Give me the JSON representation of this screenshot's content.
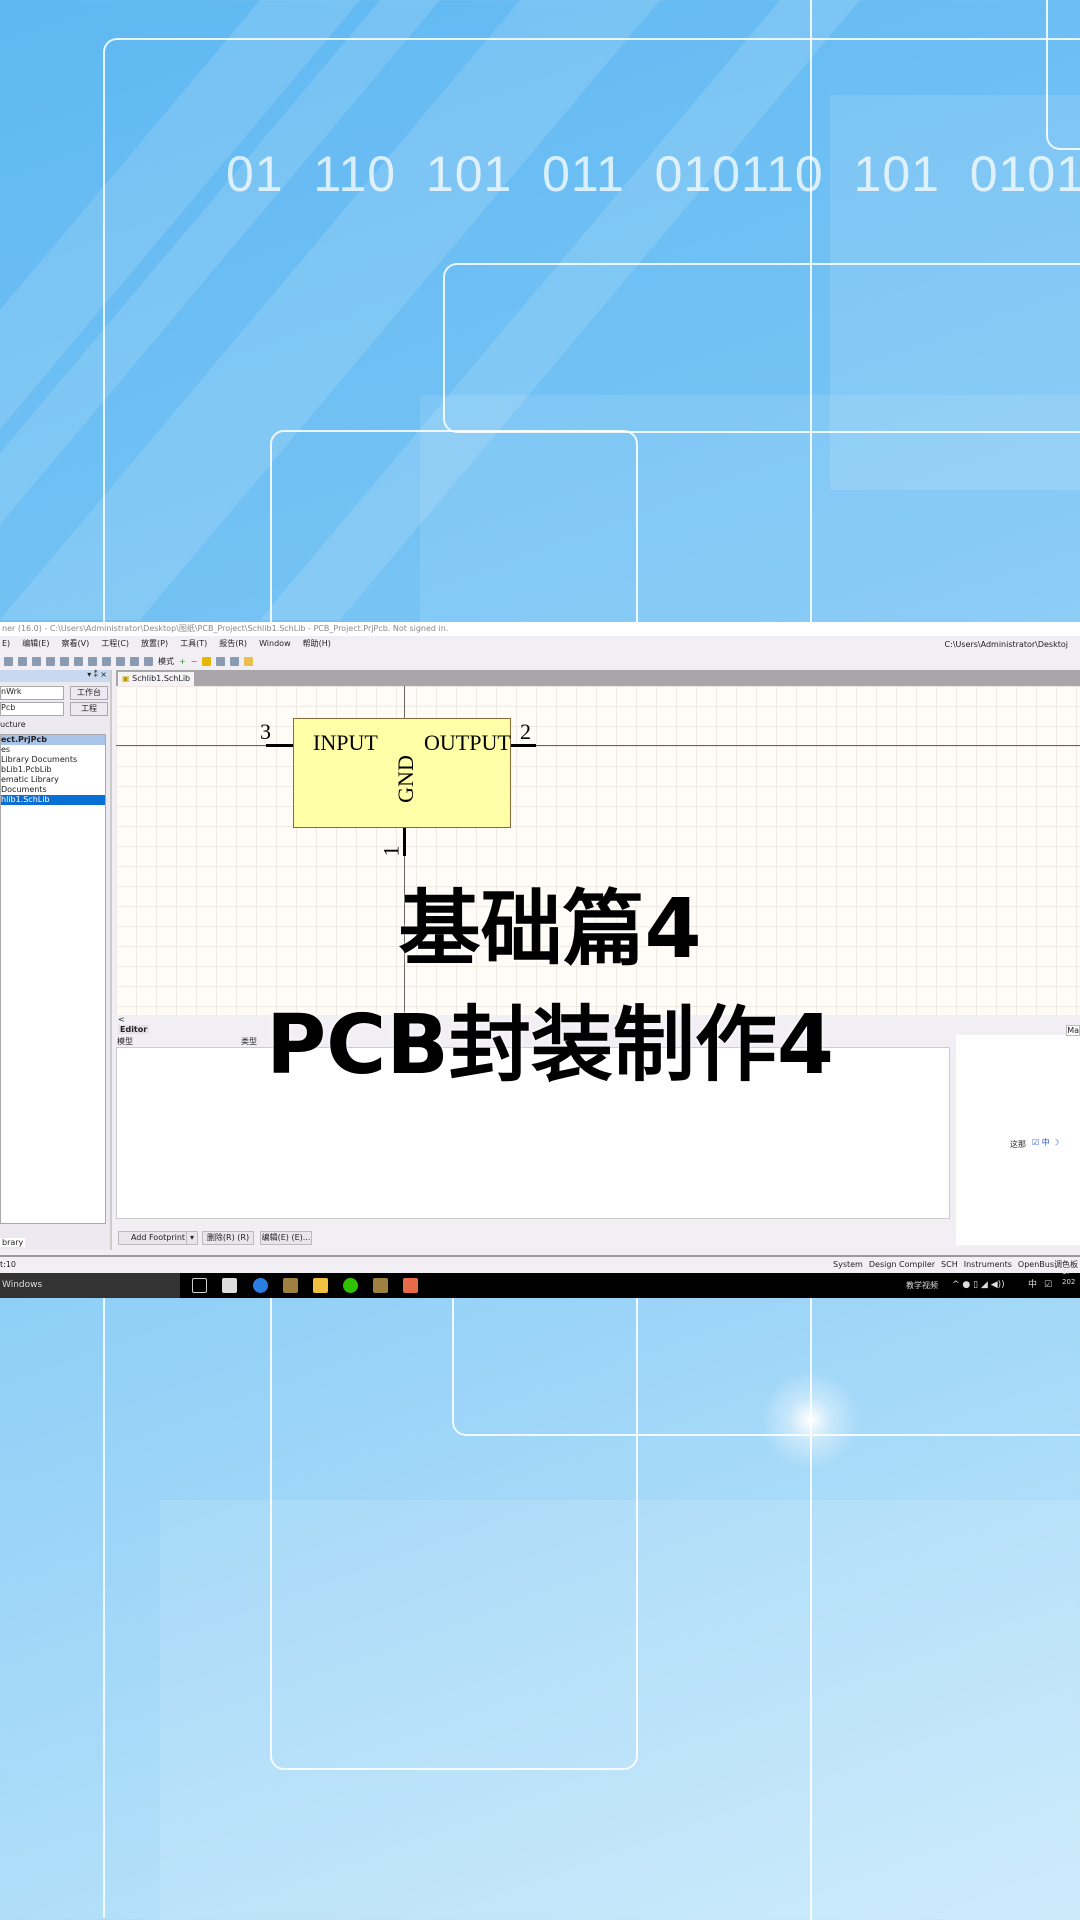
{
  "background": {
    "binary_text": "01  110  101  011  010110  101  0101"
  },
  "app": {
    "title": "ner (16.0) - C:\\Users\\Administrator\\Desktop\\图纸\\PCB_Project\\Schlib1.SchLib - PCB_Project.PrjPcb. Not signed in.",
    "menu": [
      "E)",
      "编辑(E)",
      "察看(V)",
      "工程(C)",
      "放置(P)",
      "工具(T)",
      "报告(R)",
      "Window",
      "帮助(H)"
    ],
    "toolbar_mode": "模式",
    "path_box": "C:\\Users\\Administrator\\Desktoj",
    "left_panel": {
      "workspace": "nWrk",
      "workspace_btn": "工作台",
      "project": "Pcb",
      "project_btn": "工程",
      "structure": "ucture",
      "tree": [
        "ect.PrjPcb",
        "es",
        "Library Documents",
        "bLib1.PcbLib",
        "ematic Library Documents",
        "hlib1.SchLib"
      ],
      "bottom_tab": "brary"
    },
    "doc_tab": "Schlib1.SchLib",
    "schematic": {
      "pin_input_number": "3",
      "pin_output_number": "2",
      "pin_gnd_number": "1",
      "input_label": "INPUT",
      "output_label": "OUTPUT",
      "gnd_label": "GND"
    },
    "editor": {
      "label": "Editor",
      "col_model": "模型",
      "col_type": "类型",
      "scroll_left": "<",
      "add_footprint": "Add Footprint",
      "delete": "删除(R) (R)",
      "edit": "编辑(E) (E)...",
      "side_tab": "Ma",
      "ime_label": "这那"
    },
    "status": {
      "left": "t:10",
      "panels": [
        "System",
        "Design Compiler",
        "SCH",
        "Instruments",
        "OpenBus调色板"
      ]
    },
    "taskbar": {
      "search": "Windows",
      "tray_text": "教学视频",
      "lang": "中",
      "clock_top": "1!",
      "clock_bottom": "202"
    }
  },
  "overlay": {
    "line1": "基础篇4",
    "line2": "PCB封装制作4"
  }
}
